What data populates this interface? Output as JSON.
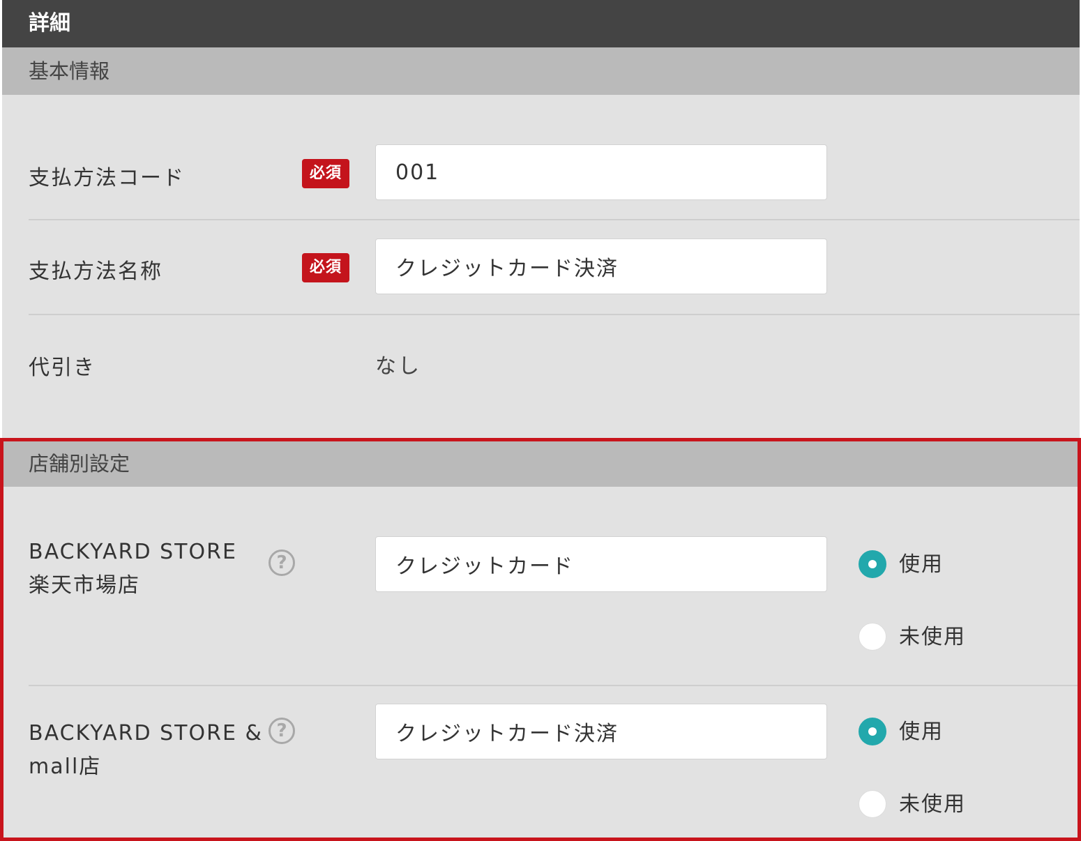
{
  "header": {
    "title": "詳細"
  },
  "basic_info": {
    "title": "基本情報",
    "payment_code": {
      "label": "支払方法コード",
      "required_badge": "必須",
      "value": "001"
    },
    "payment_name": {
      "label": "支払方法名称",
      "required_badge": "必須",
      "value": "クレジットカード決済"
    },
    "cod": {
      "label": "代引き",
      "value": "なし"
    }
  },
  "store_settings": {
    "title": "店舗別設定",
    "stores": [
      {
        "label_line1": "BACKYARD STORE",
        "label_line2": "楽天市場店",
        "help_icon": "?",
        "value": "クレジットカード",
        "use_label": "使用",
        "unused_label": "未使用",
        "selected": "使用"
      },
      {
        "label_line1": "BACKYARD STORE &",
        "label_line2": "mall店",
        "help_icon": "?",
        "value": "クレジットカード決済",
        "use_label": "使用",
        "unused_label": "未使用",
        "selected": "使用"
      }
    ]
  },
  "colors": {
    "titlebar": "#444444",
    "section_header": "#bababa",
    "section_body": "#e2e2e2",
    "required_badge": "#c4141c",
    "radio_checked": "#22a8ac",
    "highlight_border": "#c8141c"
  },
  "icons": {
    "help": "question-circle-icon",
    "radio_checked": "radio-checked-icon",
    "radio_unchecked": "radio-unchecked-icon"
  }
}
